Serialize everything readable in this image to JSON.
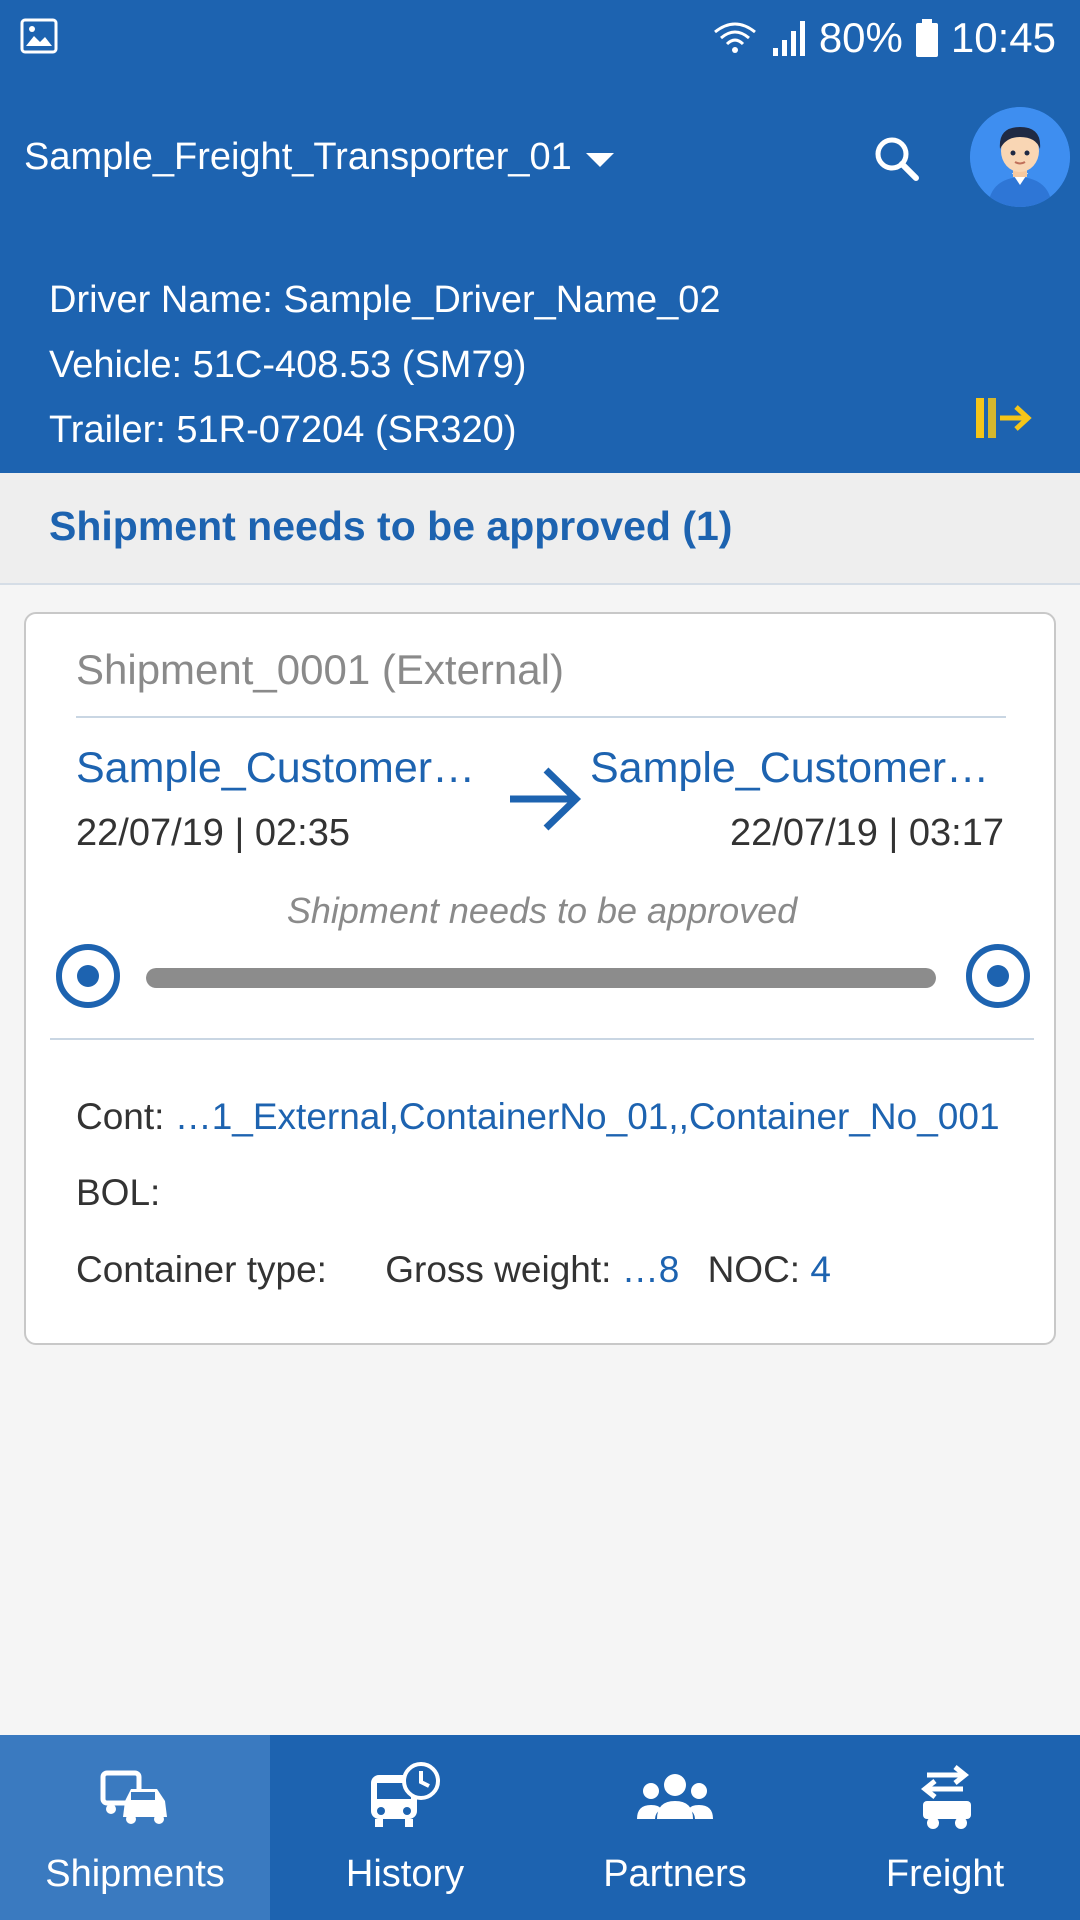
{
  "status_bar": {
    "battery": "80%",
    "time": "10:45"
  },
  "header": {
    "company": "Sample_Freight_Transporter_01",
    "driver_line": "Driver Name: Sample_Driver_Name_02",
    "vehicle_line": "Vehicle: 51C-408.53 (SM79)",
    "trailer_line": "Trailer: 51R-07204 (SR320)"
  },
  "section": {
    "title": "Shipment needs to be approved (1)"
  },
  "shipment": {
    "title": "Shipment_0001 (External)",
    "from_name": "Sample_Customer_…",
    "from_time": "22/07/19 | 02:35",
    "to_name": "Sample_Customer_…",
    "to_time": "22/07/19 | 03:17",
    "status": "Shipment needs to be approved",
    "progress": 1.0,
    "cont_label": "Cont:",
    "cont_value": "…1_External,ContainerNo_01,,Container_No_001",
    "bol_label": "BOL:",
    "container_type_label": "Container type:",
    "gross_weight_label": "Gross weight:",
    "gross_weight_value": "…8",
    "noc_label": "NOC:",
    "noc_value": "4"
  },
  "nav": {
    "shipments": "Shipments",
    "history": "History",
    "partners": "Partners",
    "freight": "Freight"
  },
  "colors": {
    "primary": "#1d63b0",
    "active_tab": "#3a7ac0",
    "logout_icon": "#f5c518"
  },
  "icons": {
    "status_bar": [
      "gallery-icon",
      "wifi-icon",
      "signal-icon",
      "battery-icon"
    ],
    "header": [
      "dropdown-caret-icon",
      "search-icon",
      "avatar",
      "logout-icon"
    ],
    "nav": [
      "truck-car-icon",
      "bus-clock-icon",
      "people-icon",
      "freight-icon"
    ]
  }
}
